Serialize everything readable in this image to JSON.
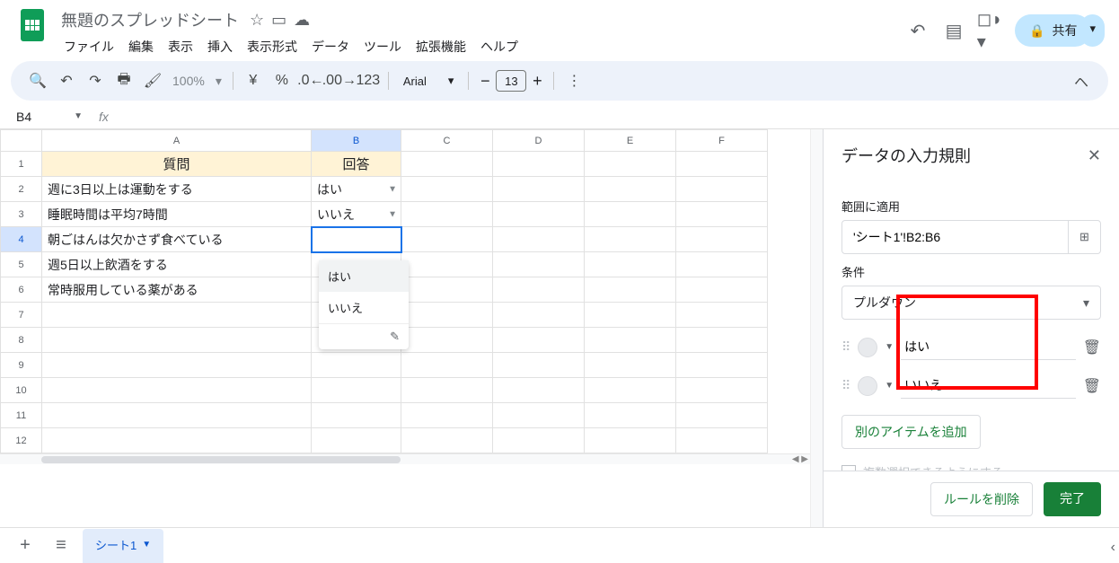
{
  "doc_title": "無題のスプレッドシート",
  "menus": [
    "ファイル",
    "編集",
    "表示",
    "挿入",
    "表示形式",
    "データ",
    "ツール",
    "拡張機能",
    "ヘルプ"
  ],
  "share_label": "共有",
  "toolbar": {
    "zoom": "100%",
    "currency": "¥",
    "percent": "%",
    "font": "Arial",
    "font_size": "13",
    "number_format": "123"
  },
  "name_box": "B4",
  "columns": [
    "A",
    "B",
    "C",
    "D",
    "E",
    "F"
  ],
  "selected_col": "B",
  "selected_row": 4,
  "headers": {
    "A": "質問",
    "B": "回答"
  },
  "rows": [
    {
      "q": "週に3日以上は運動をする",
      "a": "はい"
    },
    {
      "q": "睡眠時間は平均7時間",
      "a": "いいえ"
    },
    {
      "q": "朝ごはんは欠かさず食べている",
      "a": ""
    },
    {
      "q": "週5日以上飲酒をする",
      "a": ""
    },
    {
      "q": "常時服用している薬がある",
      "a": ""
    }
  ],
  "dropdown": {
    "options": [
      "はい",
      "いいえ"
    ],
    "edit_icon": "✎"
  },
  "sidebar": {
    "title": "データの入力規則",
    "range_label": "範囲に適用",
    "range_value": "'シート1'!B2:B6",
    "condition_label": "条件",
    "condition_value": "プルダウン",
    "options": [
      "はい",
      "いいえ"
    ],
    "add_item": "別のアイテムを追加",
    "multi_select": "複数選択できるようにする",
    "delete_rule": "ルールを削除",
    "done": "完了"
  },
  "sheet_tab": "シート1"
}
